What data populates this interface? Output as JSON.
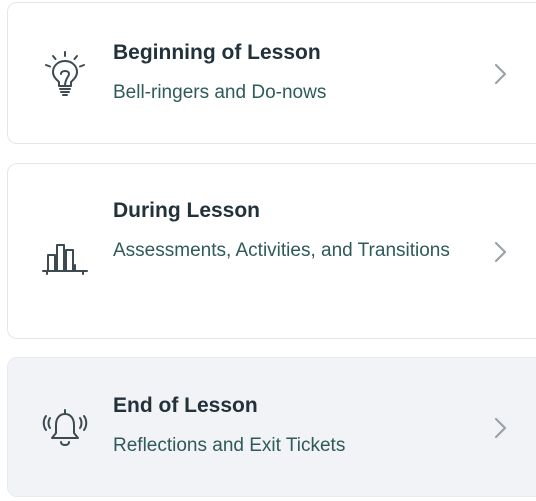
{
  "cards": [
    {
      "title": "Beginning of Lesson",
      "subtitle": "Bell-ringers and Do-nows",
      "icon": "lightbulb-icon"
    },
    {
      "title": "During Lesson",
      "subtitle": "Assessments, Activities, and Transitions",
      "icon": "bar-chart-icon"
    },
    {
      "title": "End of Lesson",
      "subtitle": "Reflections and Exit Tickets",
      "icon": "bell-ringing-icon"
    }
  ],
  "colors": {
    "title": "#22313a",
    "subtitle": "#2f5a5a",
    "icon_stroke": "#3d4a52",
    "chevron": "#9aa3a8",
    "card_border": "#e4e7ea",
    "active_card_bg": "#f1f3f6"
  }
}
